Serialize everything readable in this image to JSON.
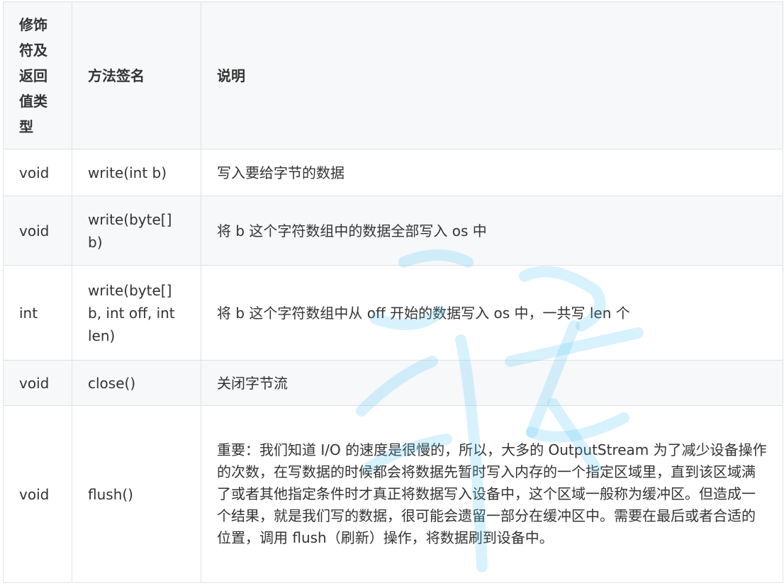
{
  "table": {
    "headers": [
      "修饰符及返回值类型",
      "方法签名",
      "说明"
    ],
    "rows": [
      [
        "void",
        "write(int b)",
        "写入要给字节的数据"
      ],
      [
        "void",
        "write(byte[] b)",
        "将 b 这个字符数组中的数据全部写入 os 中"
      ],
      [
        "int",
        "write(byte[] b, int off, int len)",
        "将 b 这个字符数组中从 off 开始的数据写入 os 中，一共写 len 个"
      ],
      [
        "void",
        "close()",
        "关闭字节流"
      ],
      [
        "void",
        "flush()",
        "重要：我们知道 I/O 的速度是很慢的，所以，大多的 OutputStream 为了减少设备操作的次数，在写数据的时候都会将数据先暂时写入内存的一个指定区域里，直到该区域满了或者其他指定条件时才真正将数据写入设备中，这个区域一般称为缓冲区。但造成一个结果，就是我们写的数据，很可能会遗留一部分在缓冲区中。需要在最后或者合适的位置，调用 flush（刷新）操作，将数据刷到设备中。"
      ]
    ]
  },
  "colors": {
    "header_bg": "#f6f8fa",
    "border": "#dfe2e5",
    "text": "#333333",
    "watermark": "#4fc3f7"
  }
}
